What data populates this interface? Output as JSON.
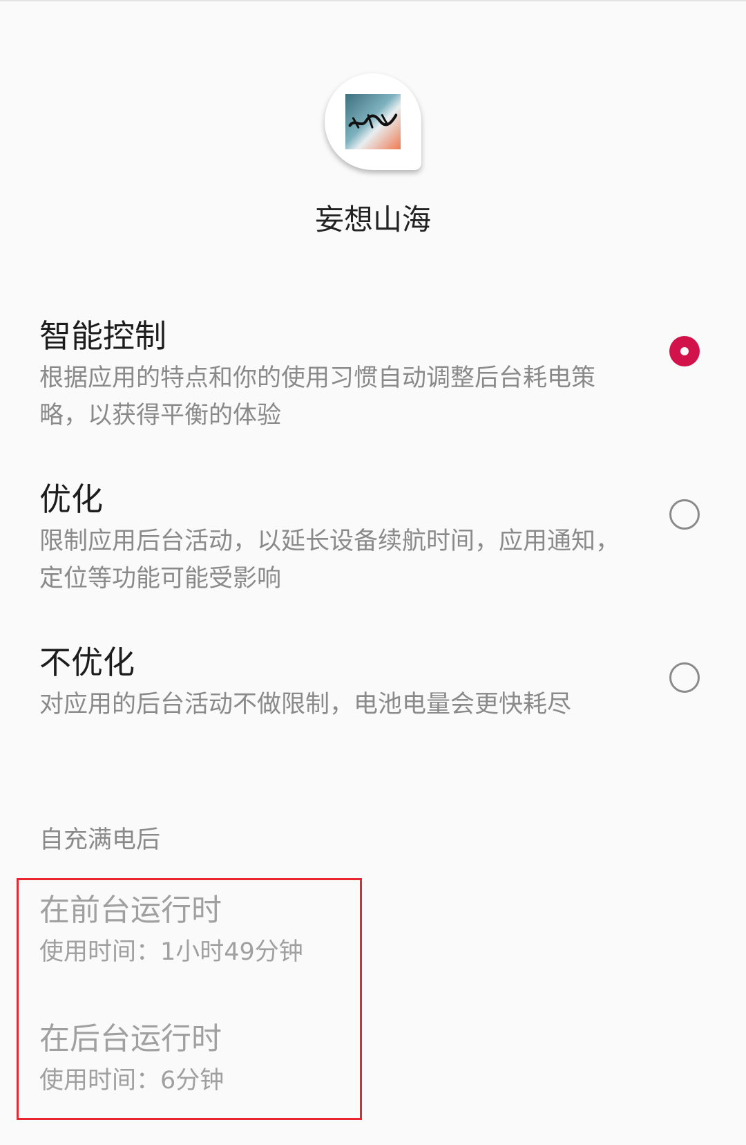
{
  "app": {
    "name": "妄想山海",
    "icon": "app-logo"
  },
  "options": [
    {
      "title": "智能控制",
      "description": "根据应用的特点和你的使用习惯自动调整后台耗电策略，以获得平衡的体验",
      "selected": true
    },
    {
      "title": "优化",
      "description": "限制应用后台活动，以延长设备续航时间，应用通知，定位等功能可能受影响",
      "selected": false
    },
    {
      "title": "不优化",
      "description": "对应用的后台活动不做限制，电池电量会更快耗尽",
      "selected": false
    }
  ],
  "usage": {
    "section_title": "自充满电后",
    "foreground": {
      "title": "在前台运行时",
      "value": "使用时间：1小时49分钟"
    },
    "background": {
      "title": "在后台运行时",
      "value": "使用时间：6分钟"
    }
  },
  "colors": {
    "accent": "#d1124b",
    "highlight_box": "#e8262f",
    "background": "#fafafa"
  }
}
